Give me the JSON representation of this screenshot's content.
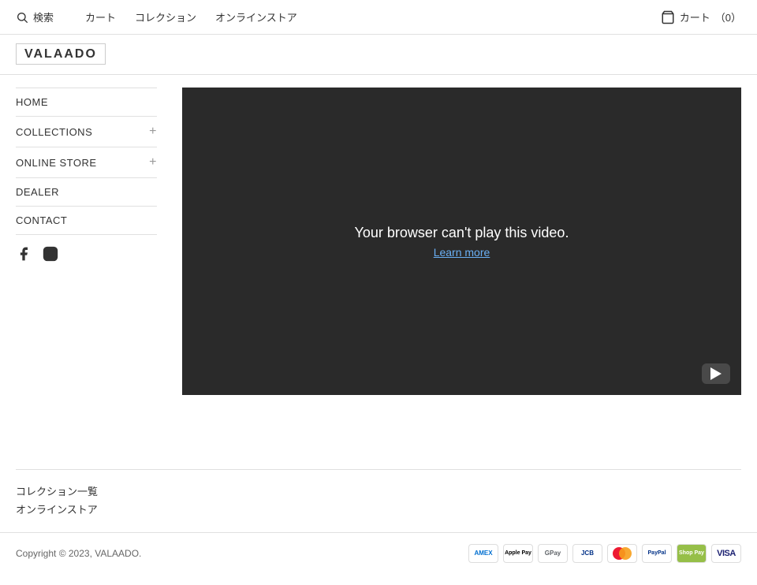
{
  "topnav": {
    "search_label": "検索",
    "link1": "カート",
    "link2": "コレクション",
    "link3": "オンラインストア",
    "cart_label": "カート",
    "cart_count": "（0）"
  },
  "logo": {
    "brand": "VALAADO"
  },
  "sidebar": {
    "items": [
      {
        "label": "HOME",
        "has_plus": false
      },
      {
        "label": "COLLECTIONS",
        "has_plus": true
      },
      {
        "label": "ONLINE STORE",
        "has_plus": true
      },
      {
        "label": "DEALER",
        "has_plus": false
      },
      {
        "label": "CONTACT",
        "has_plus": false
      }
    ]
  },
  "video": {
    "message": "Your browser can't play this video.",
    "learn_more": "Learn more"
  },
  "footer": {
    "link1": "コレクション一覧",
    "link2": "オンラインストア",
    "copyright": "Copyright © 2023, VALAADO."
  },
  "payment_methods": [
    {
      "name": "American Express",
      "label": "AMEX",
      "class": "amex"
    },
    {
      "name": "Apple Pay",
      "label": "Apple Pay",
      "class": "apple"
    },
    {
      "name": "Google Pay",
      "label": "GPay",
      "class": "gpay"
    },
    {
      "name": "JCB",
      "label": "JCB",
      "class": "jcb"
    },
    {
      "name": "Mastercard",
      "label": "MC",
      "class": "mc"
    },
    {
      "name": "PayPal",
      "label": "PayPal",
      "class": "paypal"
    },
    {
      "name": "Shop Pay",
      "label": "Shop",
      "class": "shopify"
    },
    {
      "name": "Visa",
      "label": "VISA",
      "class": "visa"
    }
  ]
}
